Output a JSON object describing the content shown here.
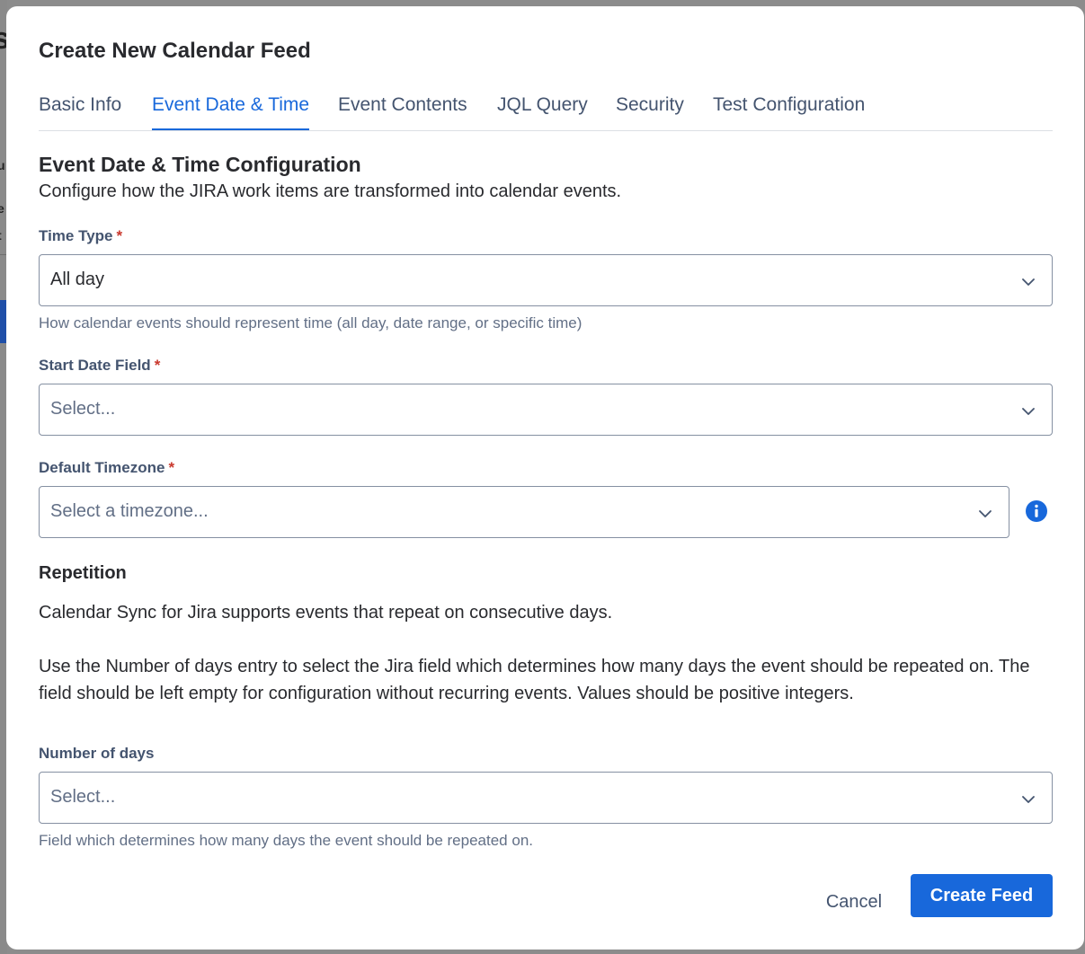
{
  "modal": {
    "title": "Create New Calendar Feed"
  },
  "tabs": [
    {
      "label": "Basic Info",
      "active": false
    },
    {
      "label": "Event Date & Time",
      "active": true
    },
    {
      "label": "Event Contents",
      "active": false
    },
    {
      "label": "JQL Query",
      "active": false
    },
    {
      "label": "Security",
      "active": false
    },
    {
      "label": "Test Configuration",
      "active": false
    }
  ],
  "section": {
    "title": "Event Date & Time Configuration",
    "description": "Configure how the JIRA work items are transformed into calendar events."
  },
  "fields": {
    "time_type": {
      "label": "Time Type",
      "required_mark": "*",
      "value": "All day",
      "helper": "How calendar events should represent time (all day, date range, or specific time)"
    },
    "start_date": {
      "label": "Start Date Field",
      "required_mark": "*",
      "placeholder": "Select..."
    },
    "timezone": {
      "label": "Default Timezone",
      "required_mark": "*",
      "placeholder": "Select a timezone..."
    },
    "number_of_days": {
      "label": "Number of days",
      "placeholder": "Select...",
      "helper": "Field which determines how many days the event should be repeated on."
    }
  },
  "repetition": {
    "heading": "Repetition",
    "paragraph1": "Calendar Sync for Jira supports events that repeat on consecutive days.",
    "paragraph2": "Use the Number of days entry to select the Jira field which determines how many days the event should be repeated on. The field should be left empty for configuration without recurring events. Values should be positive integers."
  },
  "footer": {
    "cancel_label": "Cancel",
    "create_label": "Create Feed"
  },
  "colors": {
    "accent": "#1868db",
    "required": "#c9372c",
    "text": "#292a2e",
    "subtle_text": "#626f86"
  },
  "icons": {
    "dropdown": "chevron-down-icon",
    "info": "info-icon"
  }
}
